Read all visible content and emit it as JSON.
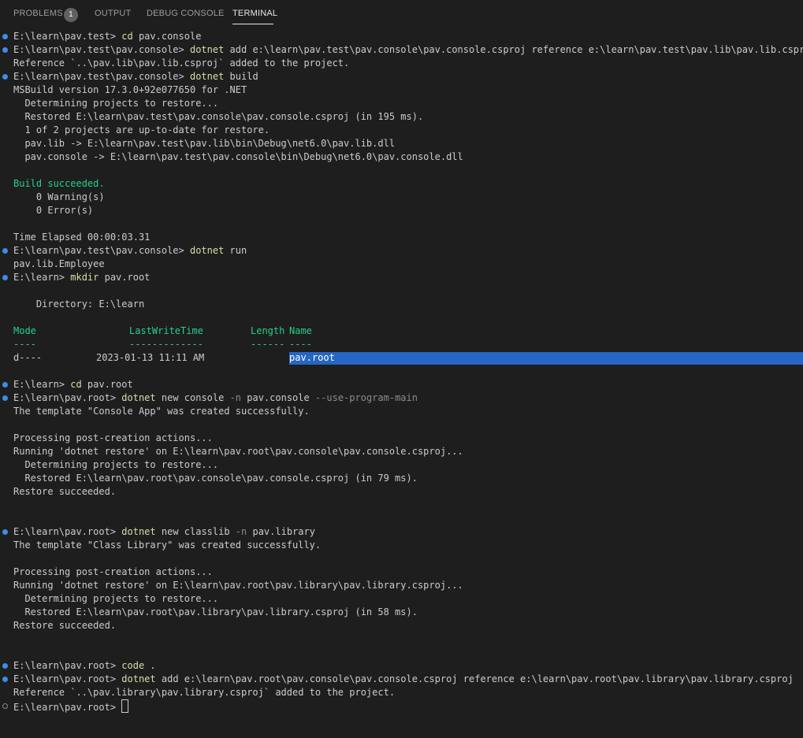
{
  "tabs": [
    {
      "label": "PROBLEMS",
      "badge": "1"
    },
    {
      "label": "OUTPUT"
    },
    {
      "label": "DEBUG CONSOLE"
    },
    {
      "label": "TERMINAL"
    }
  ],
  "terminal": {
    "l01": {
      "prompt": "E:\\learn\\pav.test> ",
      "cmd": "cd",
      "rest": " pav.console"
    },
    "l02": {
      "prompt": "E:\\learn\\pav.test\\pav.console> ",
      "cmd": "dotnet",
      "rest": " add e:\\learn\\pav.test\\pav.console\\pav.console.csproj reference e:\\learn\\pav.test\\pav.lib\\pav.lib.csproj"
    },
    "l03": "Reference `..\\pav.lib\\pav.lib.csproj` added to the project.",
    "l04": {
      "prompt": "E:\\learn\\pav.test\\pav.console> ",
      "cmd": "dotnet",
      "rest": " build"
    },
    "l05": "MSBuild version 17.3.0+92e077650 for .NET",
    "l06": "  Determining projects to restore...",
    "l07": "  Restored E:\\learn\\pav.test\\pav.console\\pav.console.csproj (in 195 ms).",
    "l08": "  1 of 2 projects are up-to-date for restore.",
    "l09": "  pav.lib -> E:\\learn\\pav.test\\pav.lib\\bin\\Debug\\net6.0\\pav.lib.dll",
    "l10": "  pav.console -> E:\\learn\\pav.test\\pav.console\\bin\\Debug\\net6.0\\pav.console.dll",
    "l11": "Build succeeded.",
    "l12": "    0 Warning(s)",
    "l13": "    0 Error(s)",
    "l14": "Time Elapsed 00:00:03.31",
    "l15": {
      "prompt": "E:\\learn\\pav.test\\pav.console> ",
      "cmd": "dotnet",
      "rest": " run"
    },
    "l16": "pav.lib.Employee",
    "l17": {
      "prompt": "E:\\learn> ",
      "cmd": "mkdir",
      "rest": " pav.root"
    },
    "l18": "    Directory: E:\\learn",
    "l19": {
      "mode": "Mode",
      "lwt": "LastWriteTime",
      "len": "Length",
      "name": "Name"
    },
    "l20": {
      "mode": "----",
      "lwt": "-------------",
      "len": "------",
      "name": "----"
    },
    "l21": {
      "mode": "d----",
      "date": "2023-01-13 11:11 AM",
      "name": "pav.root"
    },
    "l22": {
      "prompt": "E:\\learn> ",
      "cmd": "cd",
      "rest": " pav.root"
    },
    "l23": {
      "prompt": "E:\\learn\\pav.root> ",
      "cmd": "dotnet",
      "rest": " new console ",
      "f1": "-n",
      "rest2": " pav.console ",
      "f2": "--use-program-main"
    },
    "l24": "The template \"Console App\" was created successfully.",
    "l25": "Processing post-creation actions...",
    "l26": "Running 'dotnet restore' on E:\\learn\\pav.root\\pav.console\\pav.console.csproj...",
    "l27": "  Determining projects to restore...",
    "l28": "  Restored E:\\learn\\pav.root\\pav.console\\pav.console.csproj (in 79 ms).",
    "l29": "Restore succeeded.",
    "l30": {
      "prompt": "E:\\learn\\pav.root> ",
      "cmd": "dotnet",
      "rest": " new classlib ",
      "f1": "-n",
      "rest2": " pav.library"
    },
    "l31": "The template \"Class Library\" was created successfully.",
    "l32": "Processing post-creation actions...",
    "l33": "Running 'dotnet restore' on E:\\learn\\pav.root\\pav.library\\pav.library.csproj...",
    "l34": "  Determining projects to restore...",
    "l35": "  Restored E:\\learn\\pav.root\\pav.library\\pav.library.csproj (in 58 ms).",
    "l36": "Restore succeeded.",
    "l37": {
      "prompt": "E:\\learn\\pav.root> ",
      "cmd": "code",
      "rest": " ."
    },
    "l38": {
      "prompt": "E:\\learn\\pav.root> ",
      "cmd": "dotnet",
      "rest": " add e:\\learn\\pav.root\\pav.console\\pav.console.csproj reference e:\\learn\\pav.root\\pav.library\\pav.library.csproj"
    },
    "l39": "Reference `..\\pav.library\\pav.library.csproj` added to the project.",
    "l40": {
      "prompt": "E:\\learn\\pav.root> "
    }
  },
  "colors": {
    "background": "#1e1e1e",
    "text": "#cccccc",
    "command": "#dcdcaa",
    "success": "#23d18b",
    "selection": "#2666c4",
    "decoration": "#3a8ee6"
  }
}
